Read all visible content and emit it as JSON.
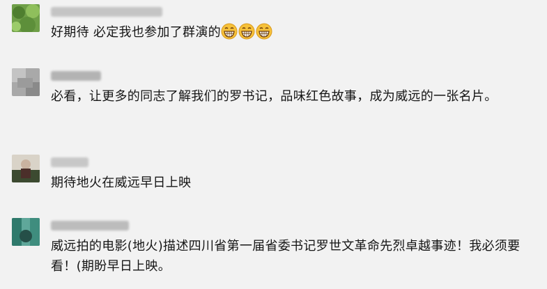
{
  "comments": [
    {
      "text": "好期待  必定我也参加了群演的",
      "emoji": [
        "grinning-face-icon",
        "grinning-face-icon",
        "grinning-face-icon"
      ],
      "avatar_colors": [
        "#5d8f3a",
        "#8fbf5c"
      ],
      "name_color": "#b9b9b9"
    },
    {
      "text": "必看，让更多的同志了解我们的罗书记，品味红色故事，成为威远的一张名片。",
      "avatar_colors": [
        "#8a8a8a",
        "#c4c4c4"
      ],
      "name_color": "#a9a9a9"
    },
    {
      "text": "期待地火在威远早日上映",
      "avatar_colors": [
        "#3c4a30",
        "#c9b2a0"
      ],
      "name_color": "#c0c0c0"
    },
    {
      "text": "威远拍的电影(地火)描述四川省第一届省委书记罗世文革命先烈卓越事迹！我必须要看！(期盼早日上映。",
      "avatar_colors": [
        "#2f7a6c",
        "#5fa79a"
      ],
      "name_color": "#b3b3b3"
    }
  ],
  "colors": {
    "background": "#f2f2f2",
    "text": "#151515",
    "emoji_face": "#f6c13a"
  }
}
